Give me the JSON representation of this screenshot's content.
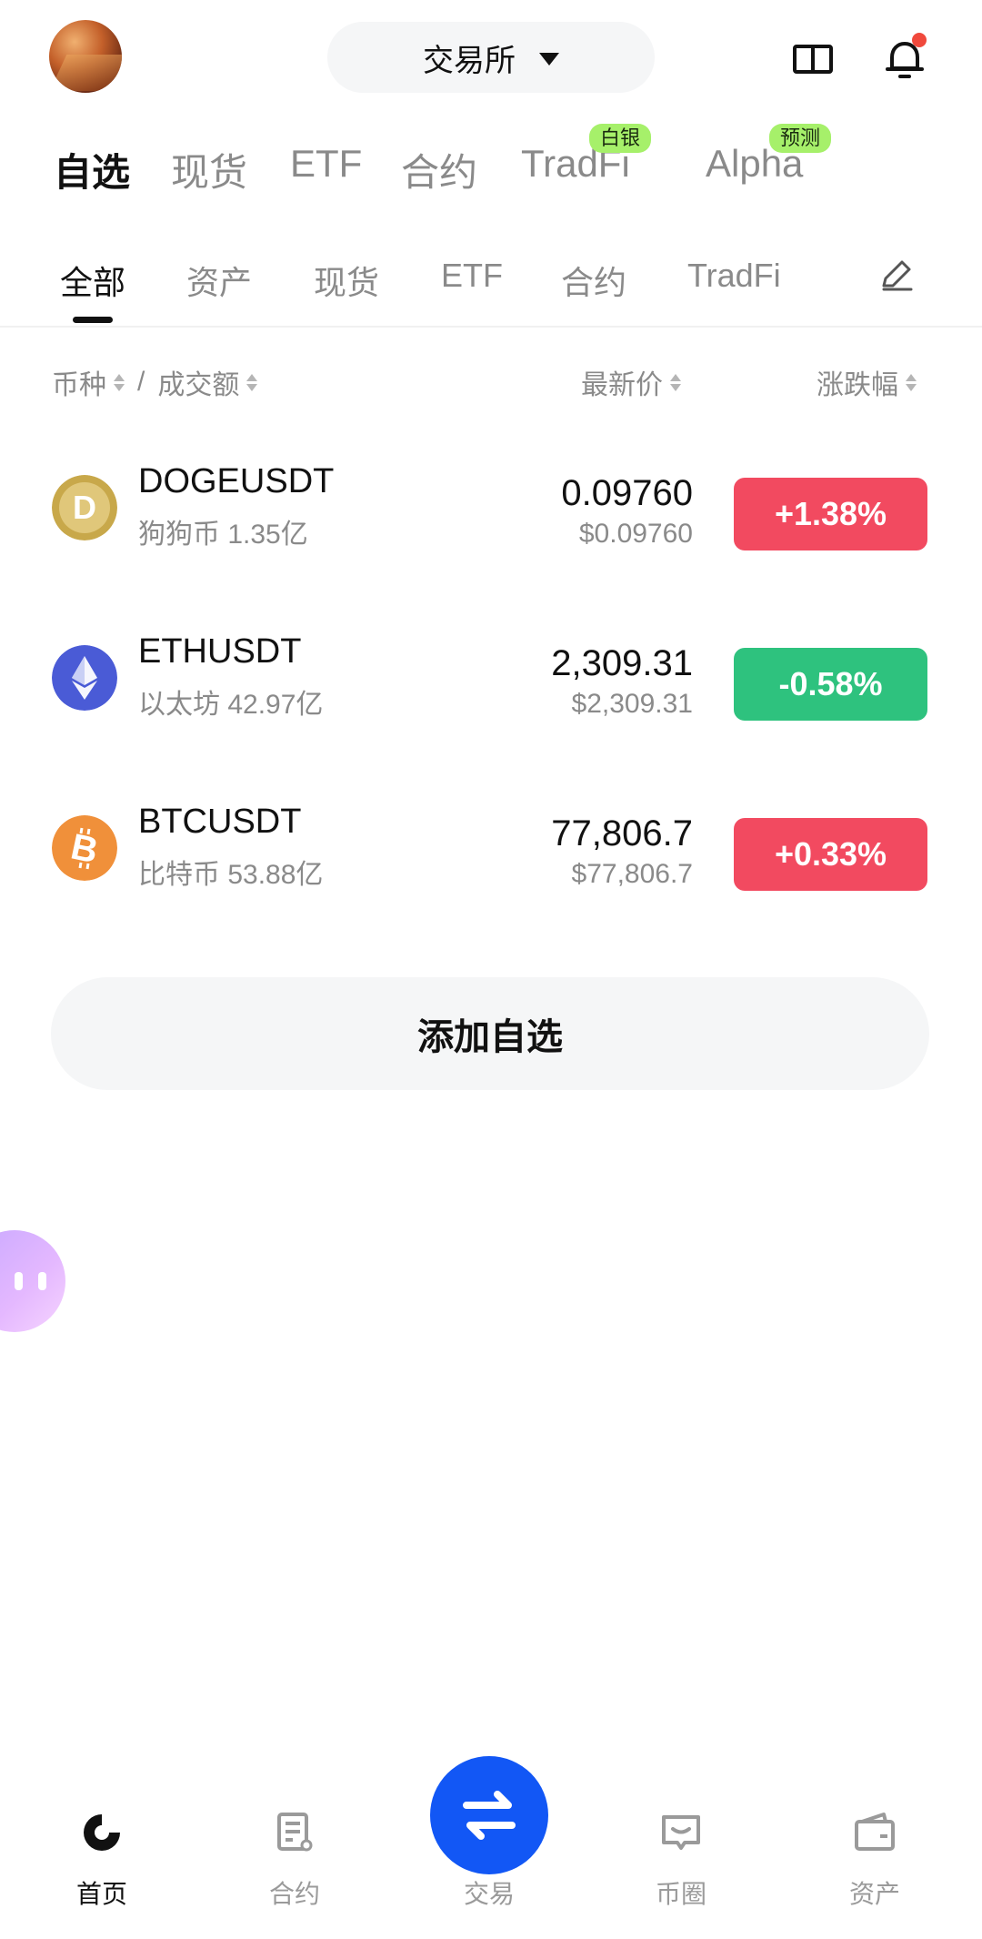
{
  "header": {
    "exchange_label": "交易所",
    "notification_dot_color": "#f0493c"
  },
  "top_tabs": [
    {
      "label": "自选",
      "active": true
    },
    {
      "label": "现货"
    },
    {
      "label": "ETF"
    },
    {
      "label": "合约"
    },
    {
      "label": "TradFi",
      "badge": "白银"
    },
    {
      "label": "Alpha",
      "badge": "预测"
    }
  ],
  "sub_tabs": [
    {
      "label": "全部",
      "active": true
    },
    {
      "label": "资产"
    },
    {
      "label": "现货"
    },
    {
      "label": "ETF"
    },
    {
      "label": "合约"
    },
    {
      "label": "TradFi"
    }
  ],
  "columns": {
    "coin": "币种",
    "separator": "/",
    "volume": "成交额",
    "last_price": "最新价",
    "change": "涨跌幅"
  },
  "rows": [
    {
      "pair": "DOGEUSDT",
      "name": "狗狗币",
      "volume": "1.35亿",
      "price": "0.09760",
      "usd": "$0.09760",
      "change": "+1.38%",
      "direction": "up",
      "icon": "doge-coin-icon"
    },
    {
      "pair": "ETHUSDT",
      "name": "以太坊",
      "volume": "42.97亿",
      "price": "2,309.31",
      "usd": "$2,309.31",
      "change": "-0.58%",
      "direction": "down",
      "icon": "eth-coin-icon"
    },
    {
      "pair": "BTCUSDT",
      "name": "比特币",
      "volume": "53.88亿",
      "price": "77,806.7",
      "usd": "$77,806.7",
      "change": "+0.33%",
      "direction": "up",
      "icon": "btc-coin-icon"
    }
  ],
  "colors": {
    "up": "#f24a60",
    "down": "#2ec27e",
    "accent": "#1257f5",
    "badge": "#a6f06a"
  },
  "add_watchlist_label": "添加自选",
  "bottom_nav": [
    {
      "label": "首页",
      "active": true
    },
    {
      "label": "合约"
    },
    {
      "label": "交易"
    },
    {
      "label": "币圈"
    },
    {
      "label": "资产"
    }
  ]
}
